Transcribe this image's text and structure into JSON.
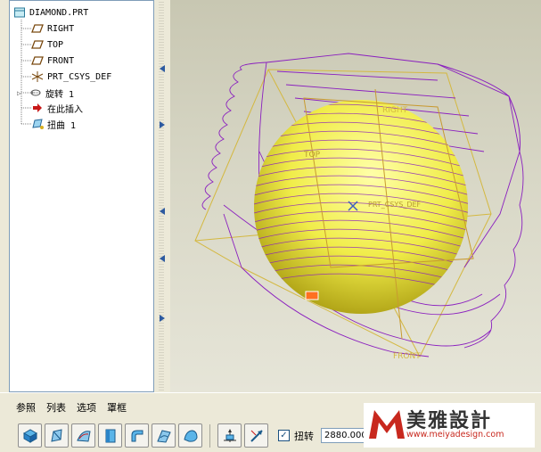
{
  "model_tree": {
    "root": "DIAMOND.PRT",
    "items": [
      {
        "label": "RIGHT",
        "icon": "datum-plane-icon"
      },
      {
        "label": "TOP",
        "icon": "datum-plane-icon"
      },
      {
        "label": "FRONT",
        "icon": "datum-plane-icon"
      },
      {
        "label": "PRT_CSYS_DEF",
        "icon": "coordinate-system-icon"
      },
      {
        "label": "旋转 1",
        "icon": "revolve-icon"
      },
      {
        "label": "在此插入",
        "icon": "insert-here-arrow-icon"
      },
      {
        "label": "扭曲 1",
        "icon": "warp-icon"
      }
    ]
  },
  "viewport": {
    "labels": {
      "right": "RIGHT",
      "front": "FRONT",
      "top": "TOP",
      "csys": "PRT_CSYS_DEF"
    },
    "colors": {
      "wireframe": "#8a1fbf",
      "sphere": "#f2f060",
      "datum": "#d4b840",
      "highlight": "#ff7020"
    }
  },
  "dashboard": {
    "tabs": [
      "参照",
      "列表",
      "选项",
      "罩框"
    ],
    "tools": [
      "transform-tool-icon",
      "warp-tool-icon",
      "spine-tool-icon",
      "stretch-tool-icon",
      "bend-tool-icon",
      "twist-tool-icon",
      "sculpt-tool-icon",
      "reorient-icon",
      "direction-icon"
    ],
    "twist_checkbox": {
      "label": "扭转",
      "checked": true
    },
    "angle_value": "2880.0000"
  },
  "logo": {
    "title": "美雅設計",
    "url": "www.meiyadesign.com",
    "brand_color": "#c8281e"
  }
}
